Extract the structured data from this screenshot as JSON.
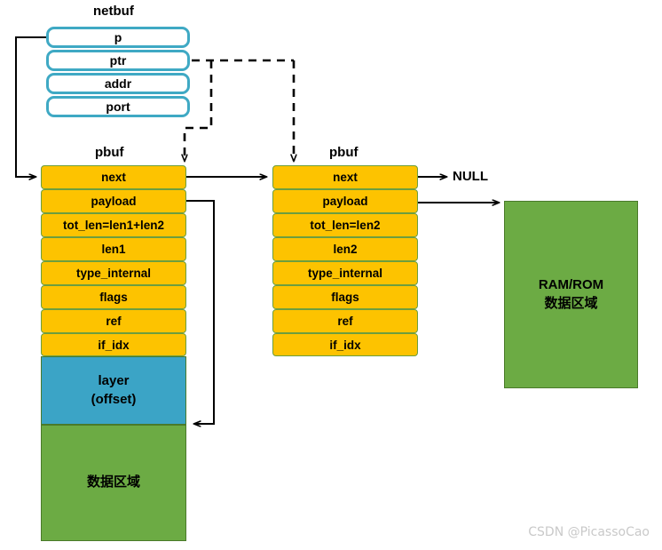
{
  "diagram": {
    "title_netbuf": "netbuf",
    "title_pbuf_1": "pbuf",
    "title_pbuf_2": "pbuf",
    "null_label": "NULL",
    "watermark": "CSDN @PicassoCao",
    "colors": {
      "netbuf_border": "#3fa9c4",
      "pbuf_fill": "#fdc300",
      "pbuf_border": "#6c9e3f",
      "layer_fill": "#3ba4c6",
      "data_fill": "#6cab44",
      "arrow": "#000000",
      "watermark": "#c9c9c9"
    }
  },
  "netbuf": {
    "label": "netbuf",
    "fields": [
      {
        "name": "p"
      },
      {
        "name": "ptr"
      },
      {
        "name": "addr"
      },
      {
        "name": "port"
      }
    ]
  },
  "pbuf1": {
    "label": "pbuf",
    "fields": [
      {
        "name": "next"
      },
      {
        "name": "payload"
      },
      {
        "name": "tot_len=len1+len2"
      },
      {
        "name": "len1"
      },
      {
        "name": "type_internal"
      },
      {
        "name": "flags"
      },
      {
        "name": "ref"
      },
      {
        "name": "if_idx"
      }
    ],
    "layer": {
      "line1": "layer",
      "line2": "(offset)"
    },
    "data_area": "数据区域"
  },
  "pbuf2": {
    "label": "pbuf",
    "fields": [
      {
        "name": "next"
      },
      {
        "name": "payload"
      },
      {
        "name": "tot_len=len2"
      },
      {
        "name": "len2"
      },
      {
        "name": "type_internal"
      },
      {
        "name": "flags"
      },
      {
        "name": "ref"
      },
      {
        "name": "if_idx"
      }
    ],
    "next_target": "NULL"
  },
  "ram_rom": {
    "line1": "RAM/ROM",
    "line2": "数据区域"
  }
}
